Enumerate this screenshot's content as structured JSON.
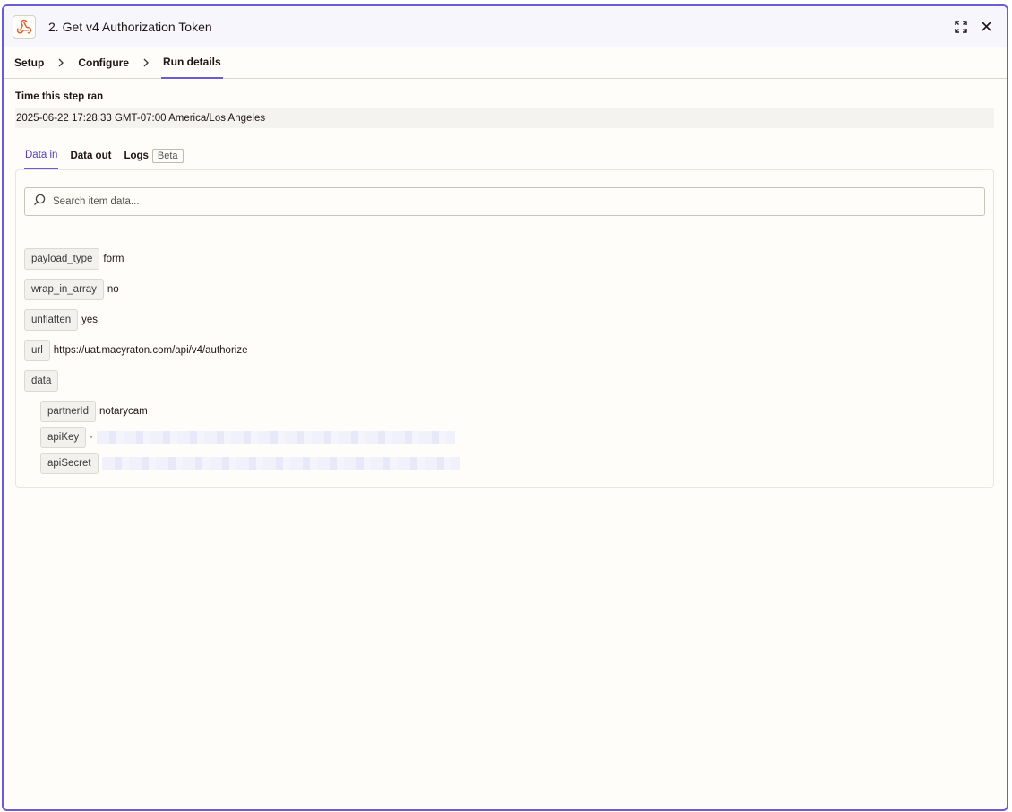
{
  "header": {
    "title": "2. Get v4 Authorization Token",
    "app_icon": "webhook-icon"
  },
  "breadcrumb": {
    "steps": [
      "Setup",
      "Configure",
      "Run details"
    ],
    "active_index": 2
  },
  "run": {
    "time_label": "Time this step ran",
    "time_value": "2025-06-22 17:28:33 GMT-07:00 America/Los Angeles"
  },
  "tabs": {
    "data_in": "Data in",
    "data_out": "Data out",
    "logs": "Logs",
    "beta": "Beta",
    "active": "Data in"
  },
  "search": {
    "placeholder": "Search item data..."
  },
  "fields": [
    {
      "key": "payload_type",
      "value": "form"
    },
    {
      "key": "wrap_in_array",
      "value": "no"
    },
    {
      "key": "unflatten",
      "value": "yes"
    },
    {
      "key": "url",
      "value": "https://uat.macyraton.com/api/v4/authorize"
    },
    {
      "key": "data",
      "value": ""
    }
  ],
  "data_children": [
    {
      "key": "partnerId",
      "value": "notarycam"
    },
    {
      "key": "apiKey",
      "value": "·",
      "redacted": true
    },
    {
      "key": "apiSecret",
      "value": "",
      "redacted": true
    }
  ],
  "colors": {
    "accent": "#6b5bd6",
    "accent_text": "#503ebc",
    "brand_icon": "#ff4f00"
  }
}
